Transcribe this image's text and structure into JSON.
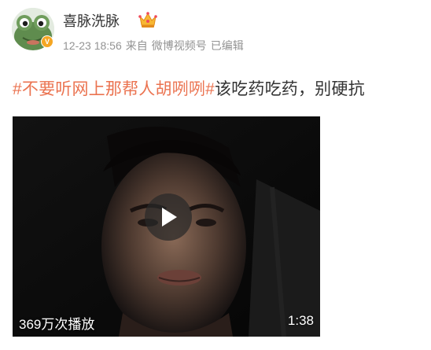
{
  "post": {
    "author": {
      "name": "喜脉洗脉",
      "avatar_icon": "frog-avatar-icon",
      "verify_badge": "V",
      "member_icon": "crown-icon"
    },
    "meta": {
      "timestamp": "12-23 18:56",
      "source_prefix": "来自",
      "source": "微博视频号",
      "edited": "已编辑"
    },
    "text": {
      "topic": "#不要听网上那帮人胡咧咧#",
      "body": "该吃药吃药，别硬抗"
    },
    "video": {
      "play_count": "369万次播放",
      "duration": "1:38",
      "play_icon": "play-icon"
    }
  },
  "colors": {
    "topic": "#eb7350",
    "meta": "#939393",
    "text": "#333333",
    "badge": "#f5a623"
  }
}
